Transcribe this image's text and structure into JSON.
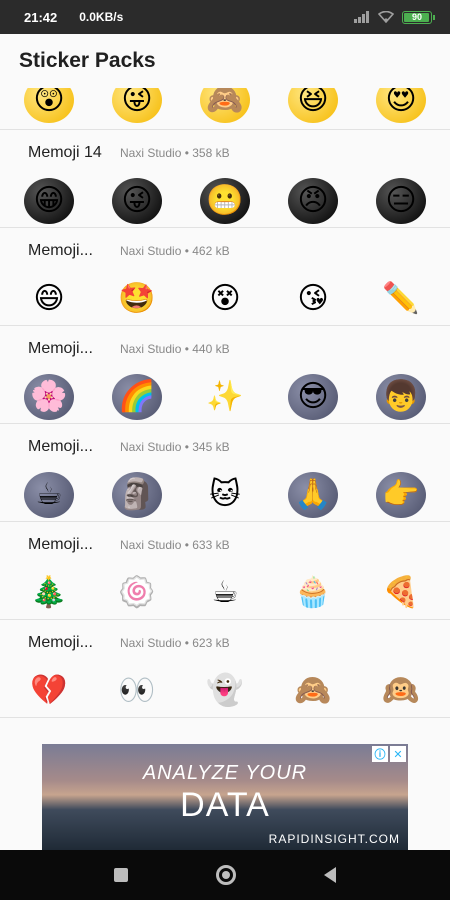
{
  "status_bar": {
    "time": "21:42",
    "network_speed": "0.0KB/s",
    "battery_level": "90"
  },
  "app_bar": {
    "title": "Sticker Packs"
  },
  "partial_row": {
    "stickers": [
      "😲",
      "😜",
      "🙈",
      "😆",
      "😍"
    ]
  },
  "packs": [
    {
      "name": "Memoji 14",
      "publisher": "Naxi Studio",
      "size": "358 kB",
      "stickers": [
        "😁",
        "😜",
        "😬",
        "😠",
        "😑"
      ]
    },
    {
      "name": "Memoji...",
      "publisher": "Naxi Studio",
      "size": "462 kB",
      "stickers": [
        "😄",
        "🤩",
        "😵",
        "😘",
        "✏️"
      ]
    },
    {
      "name": "Memoji...",
      "publisher": "Naxi Studio",
      "size": "440 kB",
      "stickers": [
        "🌸",
        "🌈",
        "✨",
        "😎",
        "👦"
      ]
    },
    {
      "name": "Memoji...",
      "publisher": "Naxi Studio",
      "size": "345 kB",
      "stickers": [
        "☕",
        "🗿",
        "🐱",
        "🙏",
        "👉"
      ]
    },
    {
      "name": "Memoji...",
      "publisher": "Naxi Studio",
      "size": "633 kB",
      "stickers": [
        "🎄",
        "🍥",
        "☕",
        "🧁",
        "🍕"
      ]
    },
    {
      "name": "Memoji...",
      "publisher": "Naxi Studio",
      "size": "623 kB",
      "stickers": [
        "💔",
        "👀",
        "👻",
        "🙈",
        "🙉"
      ]
    }
  ],
  "ad": {
    "line1": "ANALYZE YOUR",
    "line2": "DATA",
    "url": "RAPIDINSIGHT.COM",
    "info_icon": "ⓘ",
    "close_icon": "✕"
  }
}
